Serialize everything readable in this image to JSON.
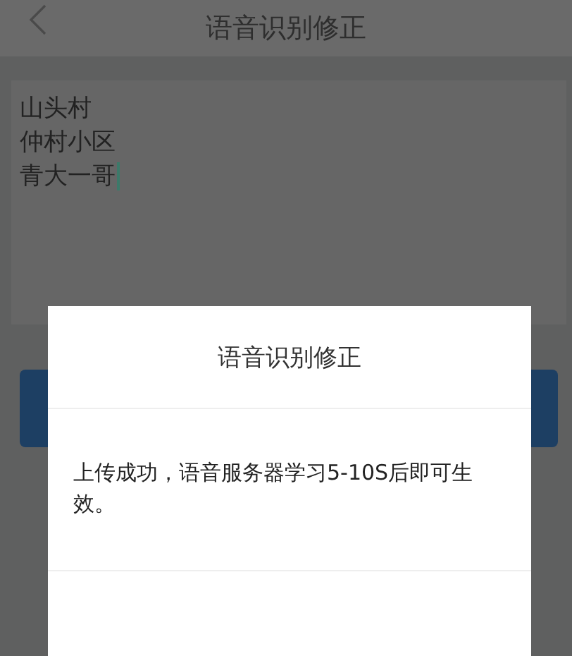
{
  "header": {
    "title": "语音识别修正"
  },
  "text_field": {
    "lines": [
      "山头村",
      "仲村小区",
      "青大一哥"
    ],
    "focused": true
  },
  "dialog": {
    "title": "语音识别修正",
    "message": "上传成功，语音服务器学习5-10S后即可生效。"
  }
}
